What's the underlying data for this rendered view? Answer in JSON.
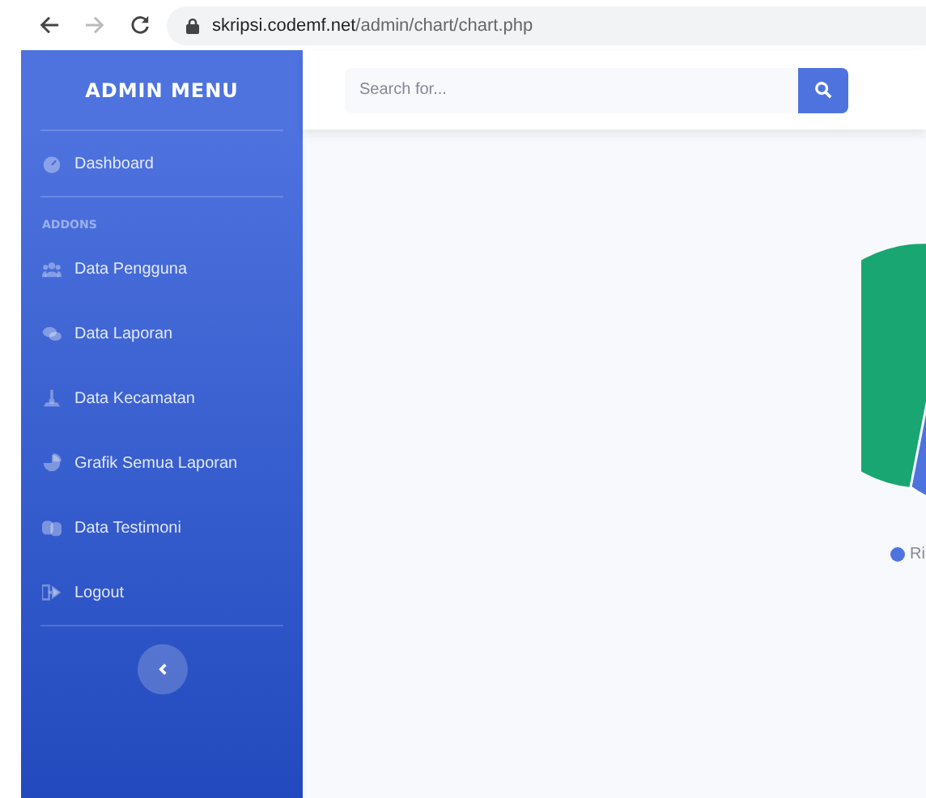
{
  "browser": {
    "url_host": "skripsi.codemf.net",
    "url_path": "/admin/chart/chart.php"
  },
  "sidebar": {
    "title": "ADMIN MENU",
    "sections": [
      {
        "items": [
          {
            "label": "Dashboard"
          }
        ]
      },
      {
        "heading": "ADDONS",
        "items": [
          {
            "label": "Data Pengguna"
          },
          {
            "label": "Data Laporan"
          },
          {
            "label": "Data Kecamatan"
          },
          {
            "label": "Grafik Semua Laporan"
          },
          {
            "label": "Data Testimoni"
          },
          {
            "label": "Logout"
          }
        ]
      }
    ]
  },
  "search": {
    "placeholder": "Search for..."
  },
  "chart": {
    "legend": [
      {
        "label": "Ri",
        "color": "#4e73df"
      }
    ]
  }
}
